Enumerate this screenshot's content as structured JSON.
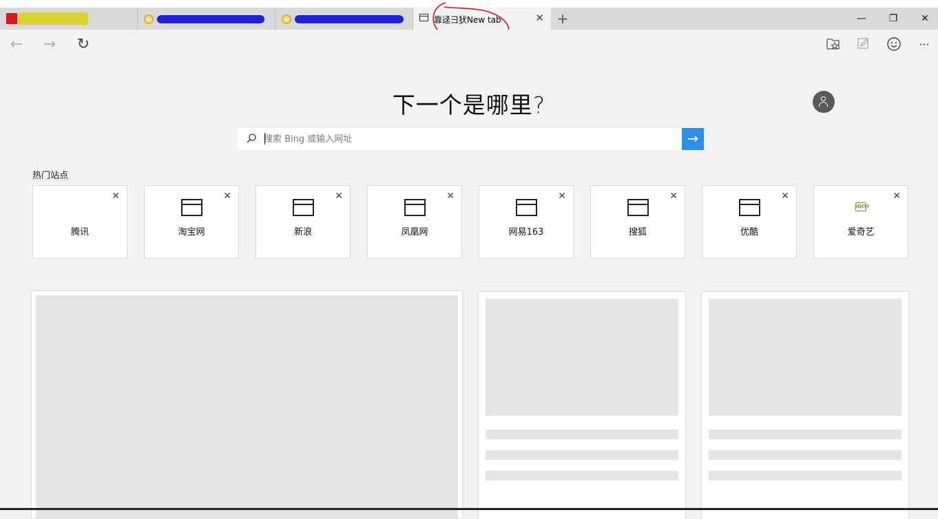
{
  "tabs": [
    {
      "favicon": "red-flag-icon",
      "title_redacted": true
    },
    {
      "favicon": "sun-icon",
      "title_redacted": true
    },
    {
      "favicon": "sun-icon",
      "title_redacted": true
    },
    {
      "favicon": "page-icon",
      "title": "靠迳彐犾New tab",
      "active": true
    }
  ],
  "window": {
    "minimize": "—",
    "restore": "❐",
    "close": "✕"
  },
  "nav": {
    "back": "←",
    "forward": "→",
    "refresh": "↻"
  },
  "toolbar": {
    "more": "···"
  },
  "heading": "下一个是哪里?",
  "search": {
    "placeholder": "搜索 Bing 或输入网址",
    "go": "→"
  },
  "top_sites": {
    "label": "热门站点",
    "sites": [
      {
        "label": "腾讯",
        "icon": "none"
      },
      {
        "label": "淘宝网",
        "icon": "page-icon"
      },
      {
        "label": "新浪",
        "icon": "page-icon"
      },
      {
        "label": "凤凰网",
        "icon": "page-icon"
      },
      {
        "label": "网易163",
        "icon": "page-icon"
      },
      {
        "label": "搜狐",
        "icon": "page-icon"
      },
      {
        "label": "优酷",
        "icon": "page-icon"
      },
      {
        "label": "爱奇艺",
        "icon": "iqiyi-icon",
        "icon_text": "iQIYI"
      }
    ]
  },
  "colors": {
    "accent": "#2b8fe8",
    "annotation": "#e0141e",
    "background": "#f2f2f2"
  }
}
